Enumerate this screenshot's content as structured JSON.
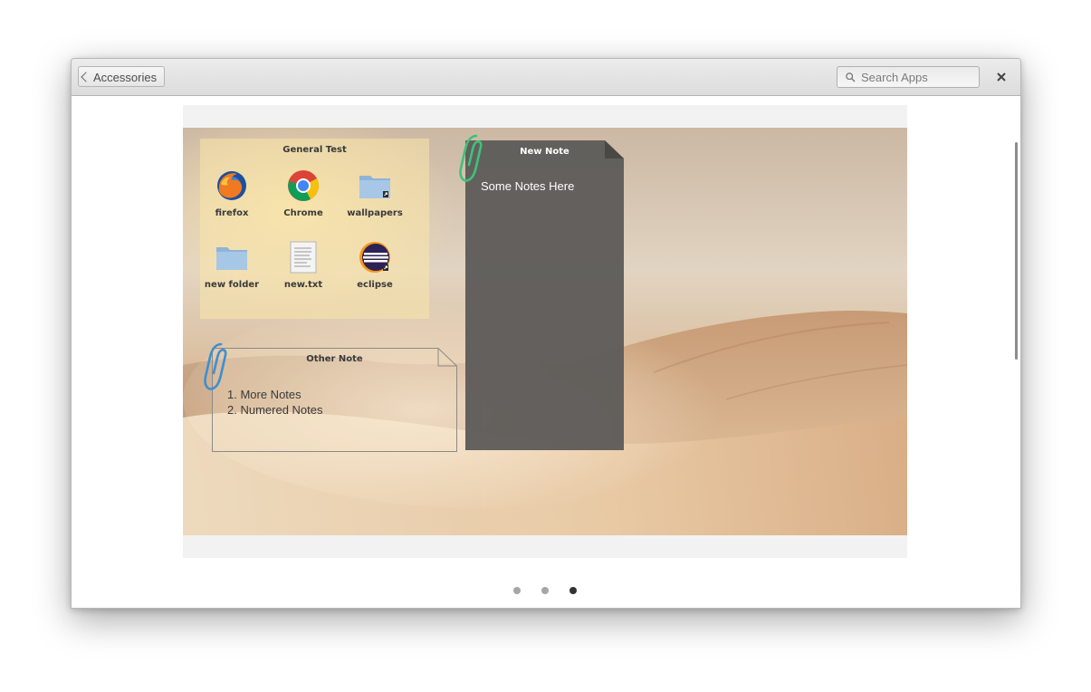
{
  "header": {
    "back_label": "Accessories",
    "search_placeholder": "Search Apps"
  },
  "icons": {
    "back": "chevron-left-icon",
    "search": "search-icon",
    "close": "close-icon"
  },
  "screenshot": {
    "folder_widget": {
      "title": "General Test",
      "items": [
        {
          "label": "firefox",
          "icon": "firefox-icon"
        },
        {
          "label": "Chrome",
          "icon": "chrome-icon"
        },
        {
          "label": "wallpapers",
          "icon": "folder-link-icon"
        },
        {
          "label": "new folder",
          "icon": "folder-icon"
        },
        {
          "label": "new.txt",
          "icon": "text-file-icon"
        },
        {
          "label": "eclipse",
          "icon": "eclipse-icon"
        }
      ]
    },
    "dark_note": {
      "title": "New Note",
      "body": "Some Notes Here"
    },
    "light_note": {
      "title": "Other Note",
      "lines": [
        "1. More Notes",
        "2. Numered Notes"
      ]
    }
  },
  "pager": {
    "count": 3,
    "active_index": 2
  },
  "colors": {
    "headerbar": "#dfdfdf",
    "dark_note": "#5e5c59",
    "pager_active": "#333333",
    "pager_inactive": "#a6a6a6",
    "clip_green": "#3ec27a",
    "clip_blue": "#3d8fd1"
  }
}
